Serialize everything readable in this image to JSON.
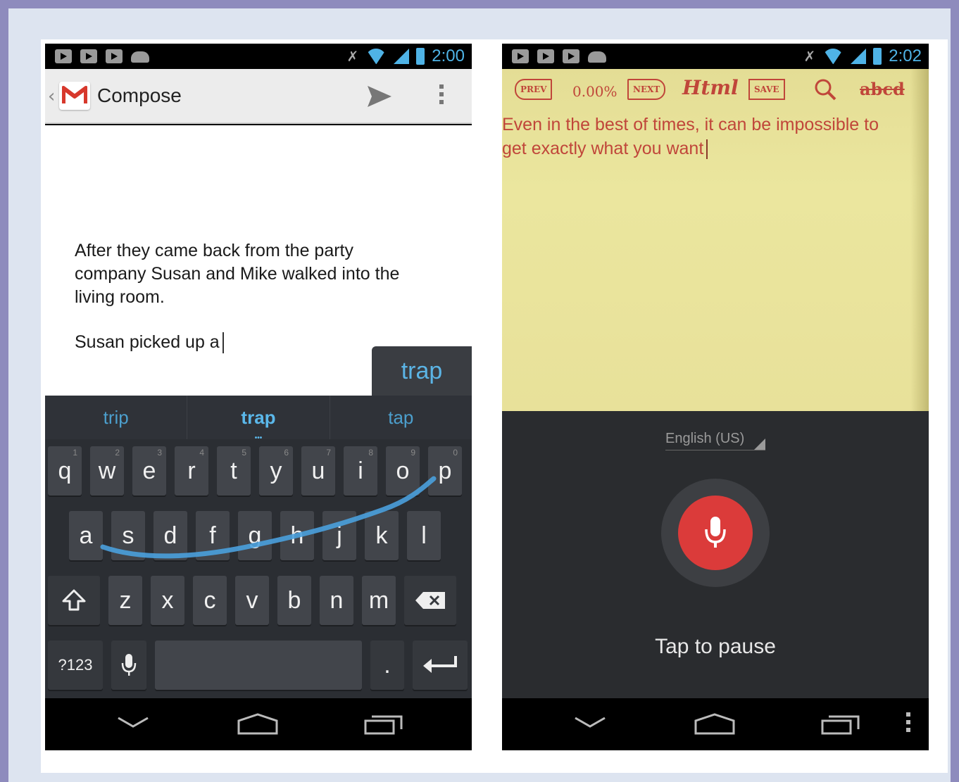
{
  "left_phone": {
    "status": {
      "time": "2:00"
    },
    "action_bar": {
      "title": "Compose",
      "app_icon": "gmail-icon",
      "send_icon": "send-icon",
      "overflow_icon": "overflow-menu-icon"
    },
    "body_text": "After they came back from the party company Susan and Mike walked into the living room.",
    "typing_line": "Susan picked up a",
    "gesture_preview": "trap",
    "suggestions": [
      "trip",
      "trap",
      "tap"
    ],
    "keyboard": {
      "row1": [
        {
          "l": "q",
          "n": "1"
        },
        {
          "l": "w",
          "n": "2"
        },
        {
          "l": "e",
          "n": "3"
        },
        {
          "l": "r",
          "n": "4"
        },
        {
          "l": "t",
          "n": "5"
        },
        {
          "l": "y",
          "n": "6"
        },
        {
          "l": "u",
          "n": "7"
        },
        {
          "l": "i",
          "n": "8"
        },
        {
          "l": "o",
          "n": "9"
        },
        {
          "l": "p",
          "n": "0"
        }
      ],
      "row2": [
        "a",
        "s",
        "d",
        "f",
        "g",
        "h",
        "j",
        "k",
        "l"
      ],
      "row3": [
        "z",
        "x",
        "c",
        "v",
        "b",
        "n",
        "m"
      ],
      "symbols_label": "?123",
      "period_label": "."
    }
  },
  "right_phone": {
    "status": {
      "time": "2:02"
    },
    "toolbar": {
      "prev": "PREV",
      "percent": "0.00%",
      "next": "NEXT",
      "html": "Html",
      "save": "SAVE",
      "abcd": "abcd"
    },
    "editor_lines": [
      "Even in the best of times, it can be impossible to",
      "get exactly what you want"
    ],
    "language": "English (US)",
    "pause_label": "Tap to pause"
  },
  "colors": {
    "accent_blue": "#4fb3e6",
    "mic_red": "#db3b3a",
    "editor_text": "#c0463a",
    "editor_bg": "#e8e19a"
  }
}
